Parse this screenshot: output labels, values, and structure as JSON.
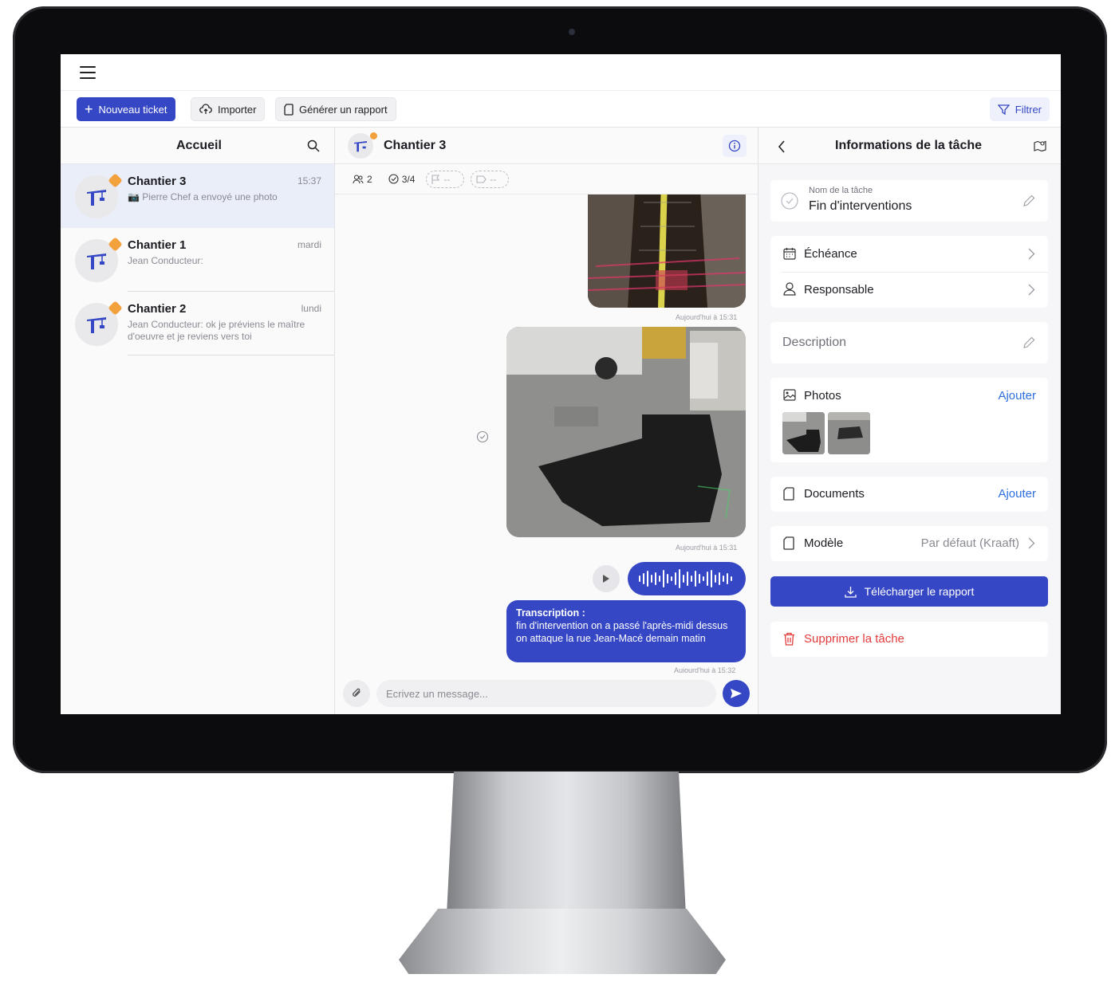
{
  "toolbar": {
    "new_ticket": "Nouveau ticket",
    "import": "Importer",
    "report": "Générer un rapport",
    "filter": "Filtrer"
  },
  "left": {
    "title": "Accueil",
    "conversations": [
      {
        "name": "Chantier 3",
        "time": "15:37",
        "preview": "📷 Pierre Chef a envoyé une photo",
        "active": true
      },
      {
        "name": "Chantier 1",
        "time": "mardi",
        "preview": "Jean Conducteur:",
        "active": false
      },
      {
        "name": "Chantier 2",
        "time": "lundi",
        "preview": "Jean Conducteur: ok je préviens le maître d'oeuvre et je reviens vers toi",
        "active": false
      }
    ]
  },
  "middle": {
    "title": "Chantier 3",
    "chips": {
      "members": "2",
      "tasks": "3/4",
      "flag": "--",
      "tag": "--"
    },
    "timestamps": [
      "Aujourd'hui à 15:31",
      "Aujourd'hui à 15:31",
      "Aujourd'hui à 15:32"
    ],
    "transcription_title": "Transcription :",
    "transcription_text": "fin d'intervention on a passé l'après-midi dessus on attaque la rue Jean-Macé demain matin",
    "placeholder": "Ecrivez un message..."
  },
  "right": {
    "title": "Informations de la tâche",
    "task_name_label": "Nom de la tâche",
    "task_name": "Fin d'interventions",
    "due": "Échéance",
    "owner": "Responsable",
    "description": "Description",
    "photos": "Photos",
    "documents": "Documents",
    "add": "Ajouter",
    "model": "Modèle",
    "model_value": "Par défaut (Kraaft)",
    "download": "Télécharger le rapport",
    "delete": "Supprimer la tâche"
  },
  "colors": {
    "accent": "#3547c4",
    "link": "#2d6fe0",
    "danger": "#e23b3b",
    "badge": "#f3a13d"
  }
}
